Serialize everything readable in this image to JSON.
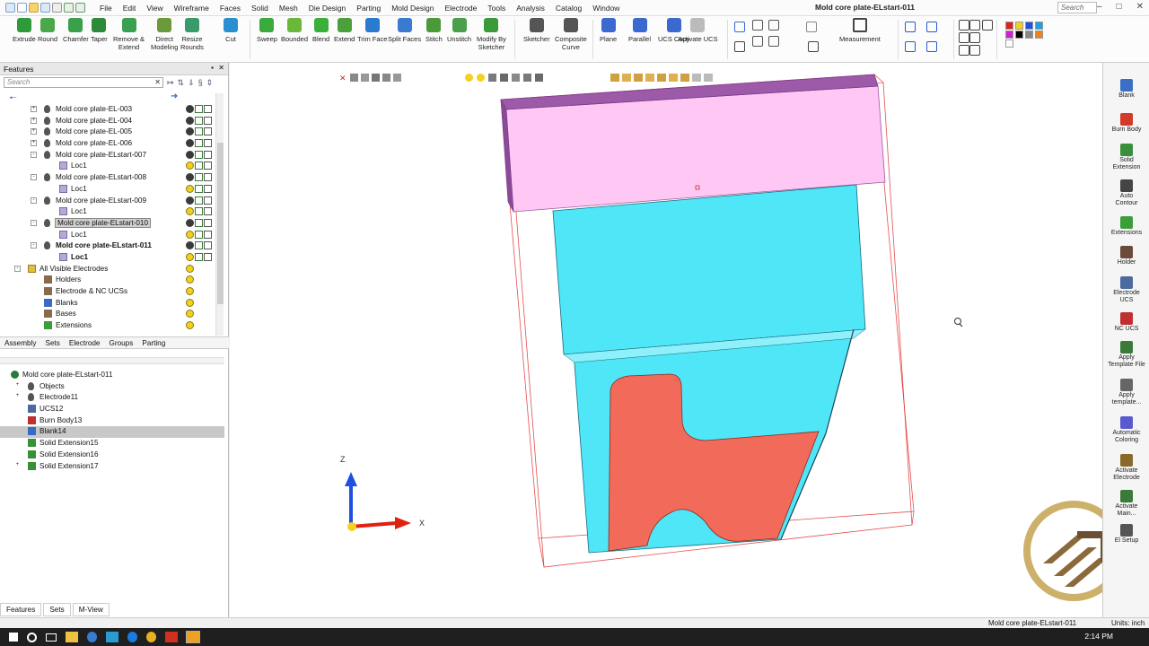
{
  "menu": {
    "items": [
      "File",
      "Edit",
      "View",
      "Wireframe",
      "Faces",
      "Solid",
      "Mesh",
      "Die Design",
      "Parting",
      "Mold Design",
      "Electrode",
      "Tools",
      "Analysis",
      "Catalog",
      "Window"
    ]
  },
  "title": "Mold core plate-ELstart-011",
  "search_placeholder": "Search",
  "ribbon": {
    "groupA": [
      "Extrude",
      "Round",
      "Chamfer",
      "Taper",
      "Remove &\nExtend",
      "Direct\nModeling",
      "Resize\nRounds",
      "Cut"
    ],
    "groupB": [
      "Sweep",
      "Bounded",
      "Blend",
      "Extend",
      "Trim Face",
      "Split Faces",
      "Stitch",
      "Unstitch",
      "Modify By\nSketcher"
    ],
    "groupC": [
      "Sketcher",
      "Composite\nCurve"
    ],
    "groupD": [
      "Plane",
      "Parallel",
      "UCS Copy",
      "Activate UCS"
    ],
    "measurement": "Measurement"
  },
  "features_panel": {
    "title": "Features",
    "search_placeholder": "Search",
    "tree": [
      {
        "label": "Mold core plate-EL-003",
        "indent": 1,
        "exp": "+",
        "icon": "bulb",
        "bold": false,
        "sel": false
      },
      {
        "label": "Mold core plate-EL-004",
        "indent": 1,
        "exp": "+",
        "icon": "bulb",
        "bold": false,
        "sel": false
      },
      {
        "label": "Mold core plate-EL-005",
        "indent": 1,
        "exp": "+",
        "icon": "bulb",
        "bold": false,
        "sel": false
      },
      {
        "label": "Mold core plate-EL-006",
        "indent": 1,
        "exp": "+",
        "icon": "bulb",
        "bold": false,
        "sel": false
      },
      {
        "label": "Mold core plate-ELstart-007",
        "indent": 1,
        "exp": "-",
        "icon": "bulb",
        "bold": false,
        "sel": false
      },
      {
        "label": "Loc1",
        "indent": 2,
        "exp": "",
        "icon": "loc",
        "bold": false,
        "sel": false
      },
      {
        "label": "Mold core plate-ELstart-008",
        "indent": 1,
        "exp": "-",
        "icon": "bulb",
        "bold": false,
        "sel": false
      },
      {
        "label": "Loc1",
        "indent": 2,
        "exp": "",
        "icon": "loc",
        "bold": false,
        "sel": false
      },
      {
        "label": "Mold core plate-ELstart-009",
        "indent": 1,
        "exp": "-",
        "icon": "bulb",
        "bold": false,
        "sel": false
      },
      {
        "label": "Loc1",
        "indent": 2,
        "exp": "",
        "icon": "loc",
        "bold": false,
        "sel": false
      },
      {
        "label": "Mold core plate-ELstart-010",
        "indent": 1,
        "exp": "-",
        "icon": "bulb",
        "bold": false,
        "sel": true
      },
      {
        "label": "Loc1",
        "indent": 2,
        "exp": "",
        "icon": "loc",
        "bold": false,
        "sel": false
      },
      {
        "label": "Mold core plate-ELstart-011",
        "indent": 1,
        "exp": "-",
        "icon": "bulb",
        "bold": true,
        "sel": false
      },
      {
        "label": "Loc1",
        "indent": 2,
        "exp": "",
        "icon": "loc",
        "bold": true,
        "sel": false
      },
      {
        "label": "All Visible Electrodes",
        "indent": 0,
        "exp": "-",
        "icon": "folder",
        "bold": false,
        "sel": false
      },
      {
        "label": "Holders",
        "indent": 1,
        "exp": "",
        "icon": "holder",
        "bold": false,
        "sel": false
      },
      {
        "label": "Electrode & NC UCSs",
        "indent": 1,
        "exp": "",
        "icon": "holder",
        "bold": false,
        "sel": false
      },
      {
        "label": "Blanks",
        "indent": 1,
        "exp": "",
        "icon": "blank",
        "bold": false,
        "sel": false
      },
      {
        "label": "Bases",
        "indent": 1,
        "exp": "",
        "icon": "holder",
        "bold": false,
        "sel": false
      },
      {
        "label": "Extensions",
        "indent": 1,
        "exp": "",
        "icon": "ext",
        "bold": false,
        "sel": false
      }
    ],
    "tabs": [
      "Assembly",
      "Sets",
      "Electrode",
      "Groups",
      "Parting"
    ],
    "tree2": [
      {
        "label": "Mold core plate-ELstart-011",
        "indent": 0,
        "exp": "",
        "icon": "eye",
        "sel": false
      },
      {
        "label": "Objects",
        "indent": 1,
        "exp": "+",
        "icon": "bulb",
        "sel": false
      },
      {
        "label": "Electrode11",
        "indent": 1,
        "exp": "+",
        "icon": "bulb",
        "sel": false
      },
      {
        "label": "UCS12",
        "indent": 1,
        "exp": "",
        "icon": "ucs",
        "sel": false
      },
      {
        "label": "Burn Body13",
        "indent": 1,
        "exp": "",
        "icon": "burn",
        "sel": false
      },
      {
        "label": "Blank14",
        "indent": 1,
        "exp": "",
        "icon": "blank",
        "sel": true
      },
      {
        "label": "Solid Extension15",
        "indent": 1,
        "exp": "",
        "icon": "solid",
        "sel": false
      },
      {
        "label": "Solid Extension16",
        "indent": 1,
        "exp": "",
        "icon": "solid",
        "sel": false
      },
      {
        "label": "Solid Extension17",
        "indent": 1,
        "exp": "+",
        "icon": "solid",
        "sel": false
      }
    ],
    "bottom_tabs": [
      "Features",
      "Sets",
      "M-View"
    ]
  },
  "axes": {
    "z": "Z",
    "x": "X"
  },
  "right_toolbar": [
    {
      "label": "Blank",
      "color": "#3b6fc4"
    },
    {
      "label": "Burn Body",
      "color": "#d43a2a"
    },
    {
      "label": "Solid\nExtension",
      "color": "#3a8f3a"
    },
    {
      "label": "Auto\nContour",
      "color": "#444444"
    },
    {
      "label": "Extensions",
      "color": "#3a9f3a"
    },
    {
      "label": "Holder",
      "color": "#6a4a3a"
    },
    {
      "label": "Electrode\nUCS",
      "color": "#4a6aa0"
    },
    {
      "label": "NC UCS",
      "color": "#c03030"
    },
    {
      "label": "Apply\nTemplate File",
      "color": "#3a7a3a"
    },
    {
      "label": "Apply\ntemplate...",
      "color": "#666666"
    },
    {
      "label": "Automatic\nColoring",
      "color": "#5a5ad0"
    },
    {
      "label": "Activate\nElectrode",
      "color": "#8a6a2a"
    },
    {
      "label": "Activate\nMain...",
      "color": "#3a7a3a"
    },
    {
      "label": "El Setup",
      "color": "#555555"
    }
  ],
  "status": {
    "object": "Mold core plate-ELstart-011",
    "units": "Units: inch"
  },
  "clock": "2:14 PM",
  "colors": {
    "pink": "#ffc8f4",
    "purple": "#9c5aa8",
    "cyan": "#4fe6f8",
    "salmon": "#f26a5a",
    "bbox": "#e03030"
  }
}
